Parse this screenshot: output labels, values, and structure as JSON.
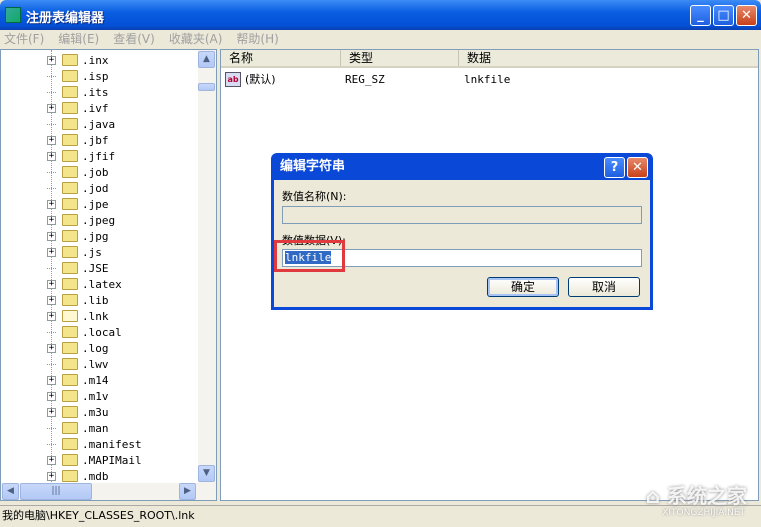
{
  "window": {
    "title": "注册表编辑器"
  },
  "menu": [
    "文件(F)",
    "编辑(E)",
    "查看(V)",
    "收藏夹(A)",
    "帮助(H)"
  ],
  "tree": [
    {
      "label": ".inx",
      "expandable": true
    },
    {
      "label": ".isp",
      "expandable": false
    },
    {
      "label": ".its",
      "expandable": false
    },
    {
      "label": ".ivf",
      "expandable": true
    },
    {
      "label": ".java",
      "expandable": false
    },
    {
      "label": ".jbf",
      "expandable": true
    },
    {
      "label": ".jfif",
      "expandable": true
    },
    {
      "label": ".job",
      "expandable": false
    },
    {
      "label": ".jod",
      "expandable": false
    },
    {
      "label": ".jpe",
      "expandable": true
    },
    {
      "label": ".jpeg",
      "expandable": true
    },
    {
      "label": ".jpg",
      "expandable": true
    },
    {
      "label": ".js",
      "expandable": true
    },
    {
      "label": ".JSE",
      "expandable": false
    },
    {
      "label": ".latex",
      "expandable": true
    },
    {
      "label": ".lib",
      "expandable": true
    },
    {
      "label": ".lnk",
      "expandable": true,
      "selected": true
    },
    {
      "label": ".local",
      "expandable": false
    },
    {
      "label": ".log",
      "expandable": true
    },
    {
      "label": ".lwv",
      "expandable": false
    },
    {
      "label": ".m14",
      "expandable": true
    },
    {
      "label": ".m1v",
      "expandable": true
    },
    {
      "label": ".m3u",
      "expandable": true
    },
    {
      "label": ".man",
      "expandable": false
    },
    {
      "label": ".manifest",
      "expandable": false
    },
    {
      "label": ".MAPIMail",
      "expandable": true
    },
    {
      "label": ".mdb",
      "expandable": true
    }
  ],
  "list": {
    "columns": [
      "名称",
      "类型",
      "数据"
    ],
    "rows": [
      {
        "name": "(默认)",
        "type": "REG_SZ",
        "data": "lnkfile"
      }
    ]
  },
  "status": "我的电脑\\HKEY_CLASSES_ROOT\\.lnk",
  "dialog": {
    "title": "编辑字符串",
    "name_label": "数值名称(N):",
    "name_value": "",
    "data_label": "数值数据(V):",
    "data_value": "lnkfile",
    "ok": "确定",
    "cancel": "取消"
  },
  "watermark": {
    "brand": "系统之家",
    "url": "XITONGZHIJIA.NET"
  }
}
